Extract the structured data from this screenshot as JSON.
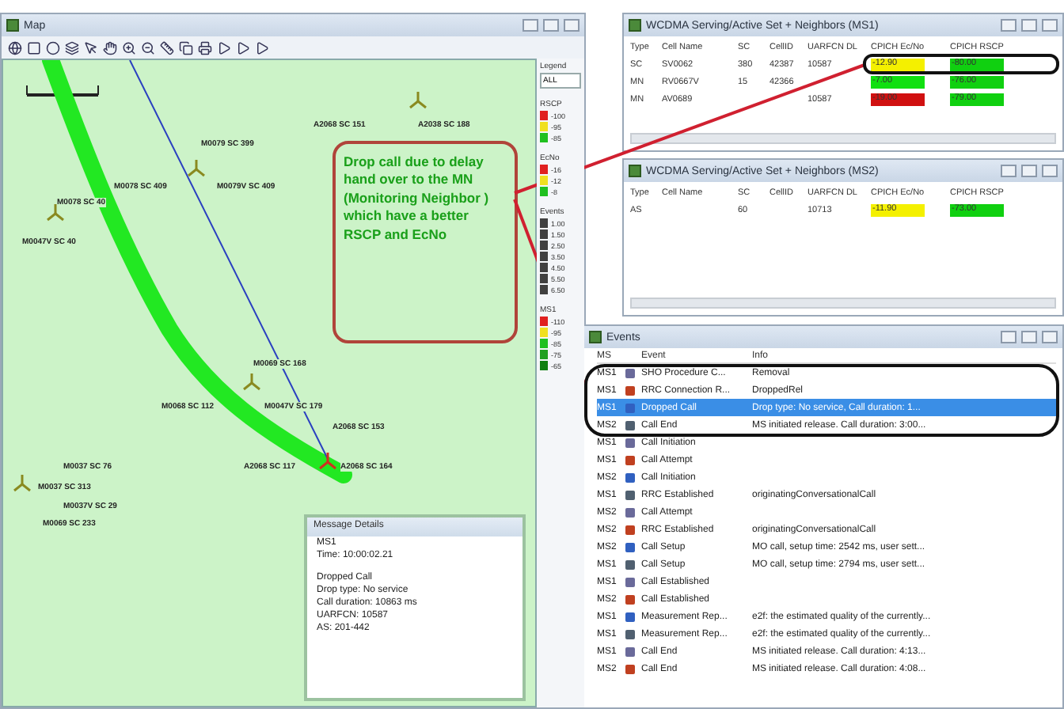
{
  "map": {
    "title": "Map",
    "sites": [
      {
        "label": "A2068 SC 151"
      },
      {
        "label": "A2038 SC 188"
      },
      {
        "label": "M0079 SC 399"
      },
      {
        "label": "M0078 SC 409"
      },
      {
        "label": "M0079V SC 409"
      },
      {
        "label": "M0078 SC 40"
      },
      {
        "label": "M0047V SC 40"
      },
      {
        "label": "M0069 SC 168"
      },
      {
        "label": "M0068 SC 112"
      },
      {
        "label": "M0047V SC 179"
      },
      {
        "label": "A2068 SC 153"
      },
      {
        "label": "M0037 SC 76"
      },
      {
        "label": "A2068 SC 117"
      },
      {
        "label": "A2068 SC 164"
      },
      {
        "label": "M0037 SC 313"
      },
      {
        "label": "M0037V SC 29"
      },
      {
        "label": "M0069 SC 233"
      }
    ],
    "callout": "Drop call due to delay hand over to the MN (Monitoring Neighbor ) which have a better RSCP and EcNo",
    "legend": {
      "title": "Legend",
      "filter": "ALL",
      "sections": [
        {
          "title": "RSCP",
          "items": [
            {
              "label": "-100",
              "color": "#e02020"
            },
            {
              "label": "-95",
              "color": "#f0e020"
            },
            {
              "label": "-85",
              "color": "#20c020"
            }
          ]
        },
        {
          "title": "EcNo",
          "items": [
            {
              "label": "-16",
              "color": "#e02020"
            },
            {
              "label": "-12",
              "color": "#f0e020"
            },
            {
              "label": "-8",
              "color": "#20c020"
            }
          ]
        },
        {
          "title": "Events",
          "items": [
            {
              "label": "1.00",
              "color": "#404040"
            },
            {
              "label": "1.50",
              "color": "#404040"
            },
            {
              "label": "2.50",
              "color": "#404040"
            },
            {
              "label": "3.50",
              "color": "#404040"
            },
            {
              "label": "4.50",
              "color": "#404040"
            },
            {
              "label": "5.50",
              "color": "#404040"
            },
            {
              "label": "6.50",
              "color": "#404040"
            }
          ]
        },
        {
          "title": "MS1",
          "items": [
            {
              "label": "-110",
              "color": "#e02020"
            },
            {
              "label": "-95",
              "color": "#f0e020"
            },
            {
              "label": "-85",
              "color": "#20c020"
            },
            {
              "label": "-75",
              "color": "#20a020"
            },
            {
              "label": "-65",
              "color": "#108010"
            }
          ]
        }
      ]
    }
  },
  "message_details": {
    "title": "Message Details",
    "lines": [
      "MS1",
      "Time: 10:00:02.21",
      "Dropped Call",
      "Drop type: No service",
      "Call duration: 10863 ms",
      "UARFCN: 10587",
      "AS: 201-442"
    ]
  },
  "neighbor_windows": [
    {
      "title": "WCDMA Serving/Active Set + Neighbors (MS1)",
      "columns": [
        "Type",
        "Cell Name",
        "SC",
        "CellID",
        "UARFCN DL",
        "CPICH Ec/No",
        "CPICH RSCP"
      ],
      "rows": [
        {
          "type": "SC",
          "cell_name": "SV0062",
          "sc": "380",
          "cell_id": "42387",
          "uarfcn": "10587",
          "ecno": {
            "text": "-12.90",
            "color": "#f4f000"
          },
          "rscp": {
            "text": "-80.00",
            "color": "#10d010"
          }
        },
        {
          "type": "MN",
          "cell_name": "RV0667V",
          "sc": "15",
          "cell_id": "42366",
          "uarfcn": "",
          "ecno": {
            "text": "-7.00",
            "color": "#10e010"
          },
          "rscp": {
            "text": "-76.00",
            "color": "#10d010"
          }
        },
        {
          "type": "MN",
          "cell_name": "AV0689",
          "sc": "",
          "cell_id": "",
          "uarfcn": "10587",
          "ecno": {
            "text": "-19.00",
            "color": "#d01010"
          },
          "rscp": {
            "text": "-79.00",
            "color": "#10d010"
          }
        }
      ]
    },
    {
      "title": "WCDMA Serving/Active Set + Neighbors (MS2)",
      "columns": [
        "Type",
        "Cell Name",
        "SC",
        "CellID",
        "UARFCN DL",
        "CPICH Ec/No",
        "CPICH RSCP"
      ],
      "rows": [
        {
          "type": "AS",
          "cell_name": "",
          "sc": "60",
          "cell_id": "",
          "uarfcn": "10713",
          "ecno": {
            "text": "-11.90",
            "color": "#f4f000"
          },
          "rscp": {
            "text": "-73.00",
            "color": "#10d010"
          }
        }
      ]
    }
  ],
  "events": {
    "title": "Events",
    "columns": [
      "MS",
      "Event",
      "Info"
    ],
    "rows": [
      {
        "ms": "MS1",
        "event": "SHO Procedure C...",
        "info": "Removal",
        "selected": false
      },
      {
        "ms": "MS1",
        "event": "RRC Connection R...",
        "info": "DroppedRel",
        "selected": false
      },
      {
        "ms": "MS1",
        "event": "Dropped Call",
        "info": "Drop type: No service, Call duration: 1...",
        "selected": true
      },
      {
        "ms": "MS2",
        "event": "Call End",
        "info": "MS initiated release. Call duration: 3:00...",
        "selected": false
      },
      {
        "ms": "MS1",
        "event": "Call Initiation",
        "info": "",
        "selected": false
      },
      {
        "ms": "MS1",
        "event": "Call Attempt",
        "info": "",
        "selected": false
      },
      {
        "ms": "MS2",
        "event": "Call Initiation",
        "info": "",
        "selected": false
      },
      {
        "ms": "MS1",
        "event": "RRC Established",
        "info": "originatingConversationalCall",
        "selected": false
      },
      {
        "ms": "MS2",
        "event": "Call Attempt",
        "info": "",
        "selected": false
      },
      {
        "ms": "MS2",
        "event": "RRC Established",
        "info": "originatingConversationalCall",
        "selected": false
      },
      {
        "ms": "MS2",
        "event": "Call Setup",
        "info": "MO call, setup time: 2542 ms, user sett...",
        "selected": false
      },
      {
        "ms": "MS1",
        "event": "Call Setup",
        "info": "MO call, setup time: 2794 ms, user sett...",
        "selected": false
      },
      {
        "ms": "MS1",
        "event": "Call Established",
        "info": "",
        "selected": false
      },
      {
        "ms": "MS2",
        "event": "Call Established",
        "info": "",
        "selected": false
      },
      {
        "ms": "MS1",
        "event": "Measurement Rep...",
        "info": "e2f: the estimated quality of the currently...",
        "selected": false
      },
      {
        "ms": "MS1",
        "event": "Measurement Rep...",
        "info": "e2f: the estimated quality of the currently...",
        "selected": false
      },
      {
        "ms": "MS1",
        "event": "Call End",
        "info": "MS initiated release. Call duration: 4:13...",
        "selected": false
      },
      {
        "ms": "MS2",
        "event": "Call End",
        "info": "MS initiated release. Call duration: 4:08...",
        "selected": false
      }
    ]
  }
}
